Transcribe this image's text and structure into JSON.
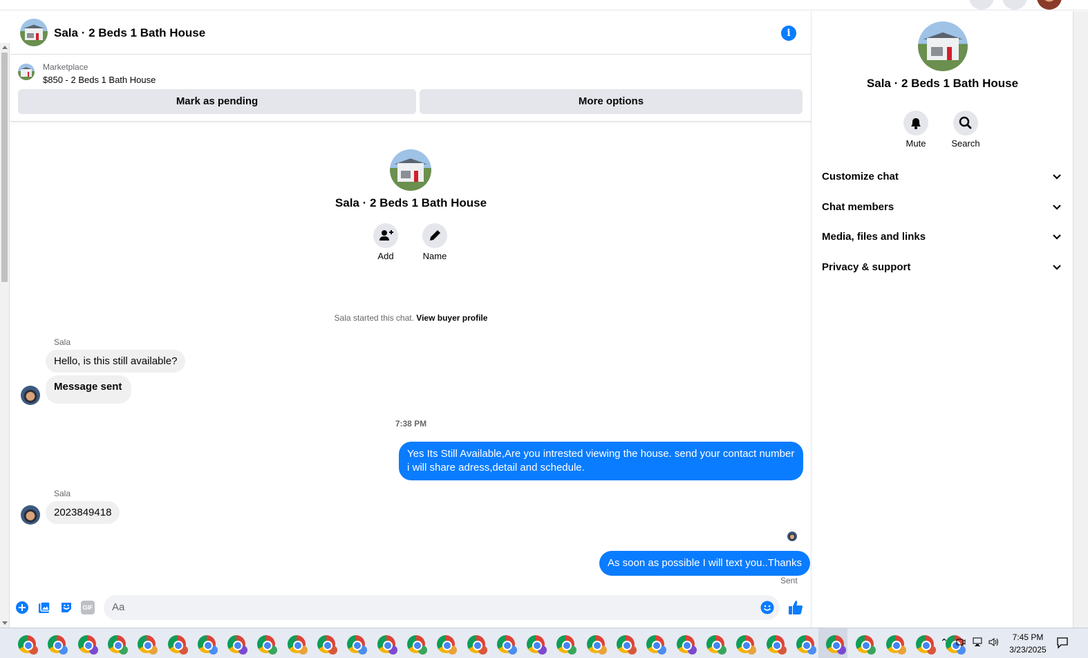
{
  "chat": {
    "title": "Sala · 2 Beds 1 Bath House",
    "marketplace_label": "Marketplace",
    "listing": "$850 - 2 Beds 1 Bath House",
    "mark_pending": "Mark as pending",
    "more_options": "More options",
    "center_title": "Sala · 2 Beds 1 Bath House",
    "add_label": "Add",
    "name_label": "Name",
    "started_text": "Sala started this chat.",
    "view_buyer_profile": "View buyer profile",
    "timestamp": "7:38 PM",
    "sent_status": "Sent",
    "input_placeholder": "Aa"
  },
  "messages": [
    {
      "sender": "Sala",
      "text": "Hello, is this still available?",
      "dir": "in"
    },
    {
      "text": "Message sent",
      "dir": "in"
    },
    {
      "text": "Yes Its Still Available,Are you intrested viewing the house. send your contact number i will share adress,detail and schedule.",
      "dir": "out"
    },
    {
      "sender": "Sala",
      "text": "2023849418",
      "dir": "in"
    },
    {
      "text": "As soon as possible I will text you..Thanks",
      "dir": "out"
    }
  ],
  "right_panel": {
    "title": "Sala · 2 Beds 1 Bath House",
    "mute_label": "Mute",
    "search_label": "Search",
    "sections": [
      "Customize chat",
      "Chat members",
      "Media, files and links",
      "Privacy & support"
    ]
  },
  "composer": {
    "gif_label": "GIF"
  },
  "taskbar": {
    "time": "7:45 PM",
    "date": "3/23/2025",
    "app_count": 32
  },
  "colors": {
    "accent": "#0a7cff",
    "bubble_in": "#f0f0f0",
    "button_bg": "#e4e6eb"
  }
}
